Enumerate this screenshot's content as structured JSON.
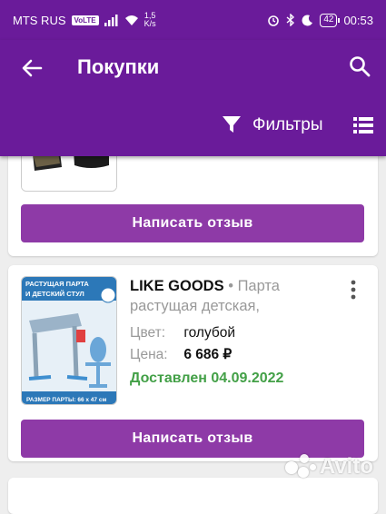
{
  "status_bar": {
    "carrier": "MTS RUS",
    "volte": "VoLTE",
    "speed_value": "1,5",
    "speed_unit": "K/s",
    "battery": "42",
    "time": "00:53"
  },
  "header": {
    "title": "Покупки",
    "filter_label": "Фильтры"
  },
  "orders": [
    {
      "review_button": "Написать отзыв"
    },
    {
      "brand": "LIKE GOODS",
      "separator": "•",
      "title": "Парта растущая детская,",
      "color_label": "Цвет:",
      "color_value": "голубой",
      "price_label": "Цена:",
      "price_value": "6 686 ₽",
      "status": "Доставлен 04.09.2022",
      "thumb_caption_top": "РАСТУЩАЯ ПАРТА И ДЕТСКИЙ СТУЛ",
      "thumb_caption_bottom": "РАЗМЕР ПАРТЫ: 66 x 47 см",
      "review_button": "Написать отзыв"
    }
  ],
  "watermark": "Avito",
  "colors": {
    "primary": "#6a1b9a",
    "button": "#8e3aa7",
    "delivered": "#43a047"
  }
}
